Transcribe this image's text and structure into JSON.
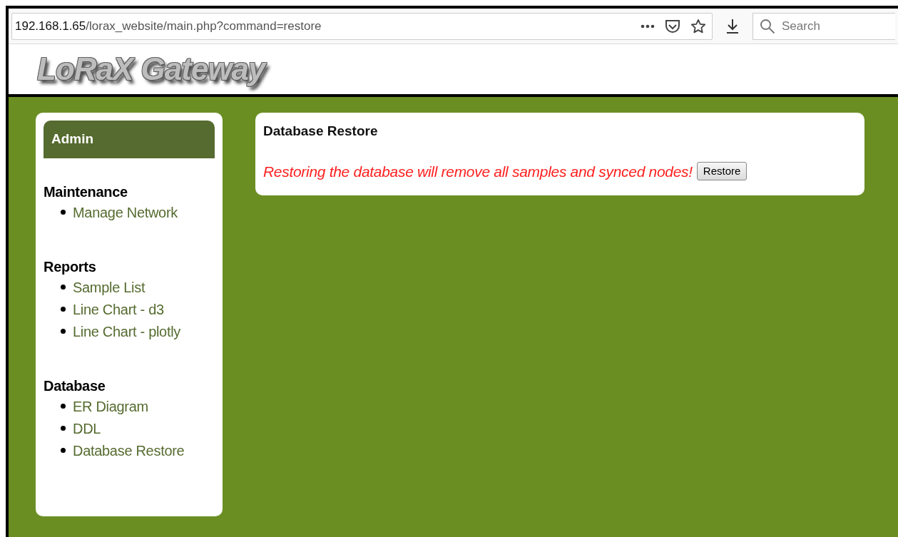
{
  "browser": {
    "url_host": "192.168.1.65",
    "url_path": "/lorax_website/main.php?command=restore",
    "search_placeholder": "Search"
  },
  "site": {
    "logo": "LoRaX Gateway"
  },
  "sidebar": {
    "title": "Admin",
    "sections": [
      {
        "heading": "Maintenance",
        "items": [
          "Manage Network"
        ]
      },
      {
        "heading": "Reports",
        "items": [
          "Sample List",
          "Line Chart - d3",
          "Line Chart - plotly"
        ]
      },
      {
        "heading": "Database",
        "items": [
          "ER Diagram",
          "DDL",
          "Database Restore"
        ]
      }
    ]
  },
  "content": {
    "title": "Database Restore",
    "warning": "Restoring the database will remove all samples and synced nodes!",
    "button": "Restore"
  }
}
